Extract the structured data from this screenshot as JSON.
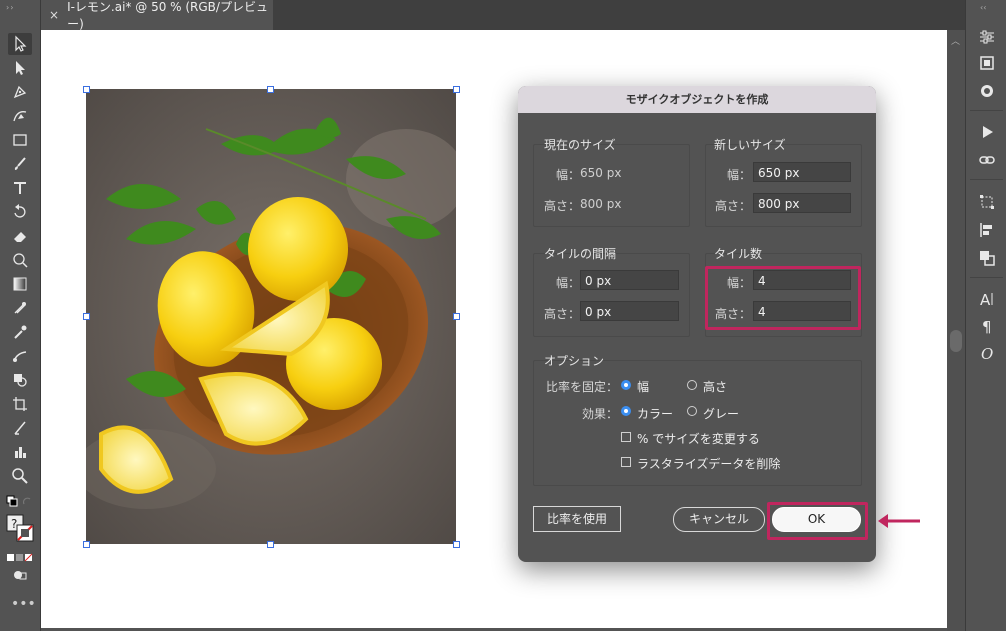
{
  "document_tab": {
    "close": "×",
    "title": "I-レモン.ai* @ 50 % (RGB/プレビュー)"
  },
  "panels": {
    "left_grip": "››",
    "right_grip": "‹‹"
  },
  "dialog": {
    "title": "モザイクオブジェクトを作成",
    "current_size": {
      "label": "現在のサイズ",
      "width_label": "幅：",
      "width_value": "650 px",
      "height_label": "高さ：",
      "height_value": "800 px"
    },
    "new_size": {
      "label": "新しいサイズ",
      "width_label": "幅：",
      "width_value": "650 px",
      "height_label": "高さ：",
      "height_value": "800 px"
    },
    "tile_spacing": {
      "label": "タイルの間隔",
      "width_label": "幅：",
      "width_value": "0 px",
      "height_label": "高さ：",
      "height_value": "0 px"
    },
    "tile_count": {
      "label": "タイル数",
      "width_label": "幅：",
      "width_value": "4",
      "height_label": "高さ：",
      "height_value": "4"
    },
    "options": {
      "label": "オプション",
      "constrain_label": "比率を固定：",
      "constrain_width": "幅",
      "constrain_height": "高さ",
      "constrain_selected": "幅",
      "result_label": "効果：",
      "result_color": "カラー",
      "result_gray": "グレー",
      "result_selected": "カラー",
      "resize_percent": "% でサイズを変更する",
      "delete_raster": "ラスタライズデータを削除"
    },
    "use_ratio_button": "比率を使用",
    "cancel_button": "キャンセル",
    "ok_button": "OK"
  },
  "accent_colors": {
    "highlight": "#c0265e",
    "selection": "#3b6fe0",
    "radio": "#3b8ef0"
  },
  "left_tools": [
    "selection-tool",
    "direct-selection-tool",
    "pen-tool",
    "curvature-tool",
    "rectangle-tool",
    "paintbrush-tool",
    "type-tool",
    "rotate-tool",
    "eraser-tool",
    "warp-tool",
    "gradient-tool",
    "mesh-tool",
    "eyedropper-tool",
    "blend-tool",
    "shape-builder-tool",
    "artboard-tool",
    "slice-tool",
    "chart-tool",
    "zoom-tool"
  ],
  "right_icons": [
    "properties-icon",
    "libraries-icon",
    "color-icon",
    "play-icon",
    "link-icon",
    "transform-icon",
    "align-icon",
    "pathfinder-icon",
    "character-icon",
    "paragraph-icon",
    "opentype-icon"
  ]
}
